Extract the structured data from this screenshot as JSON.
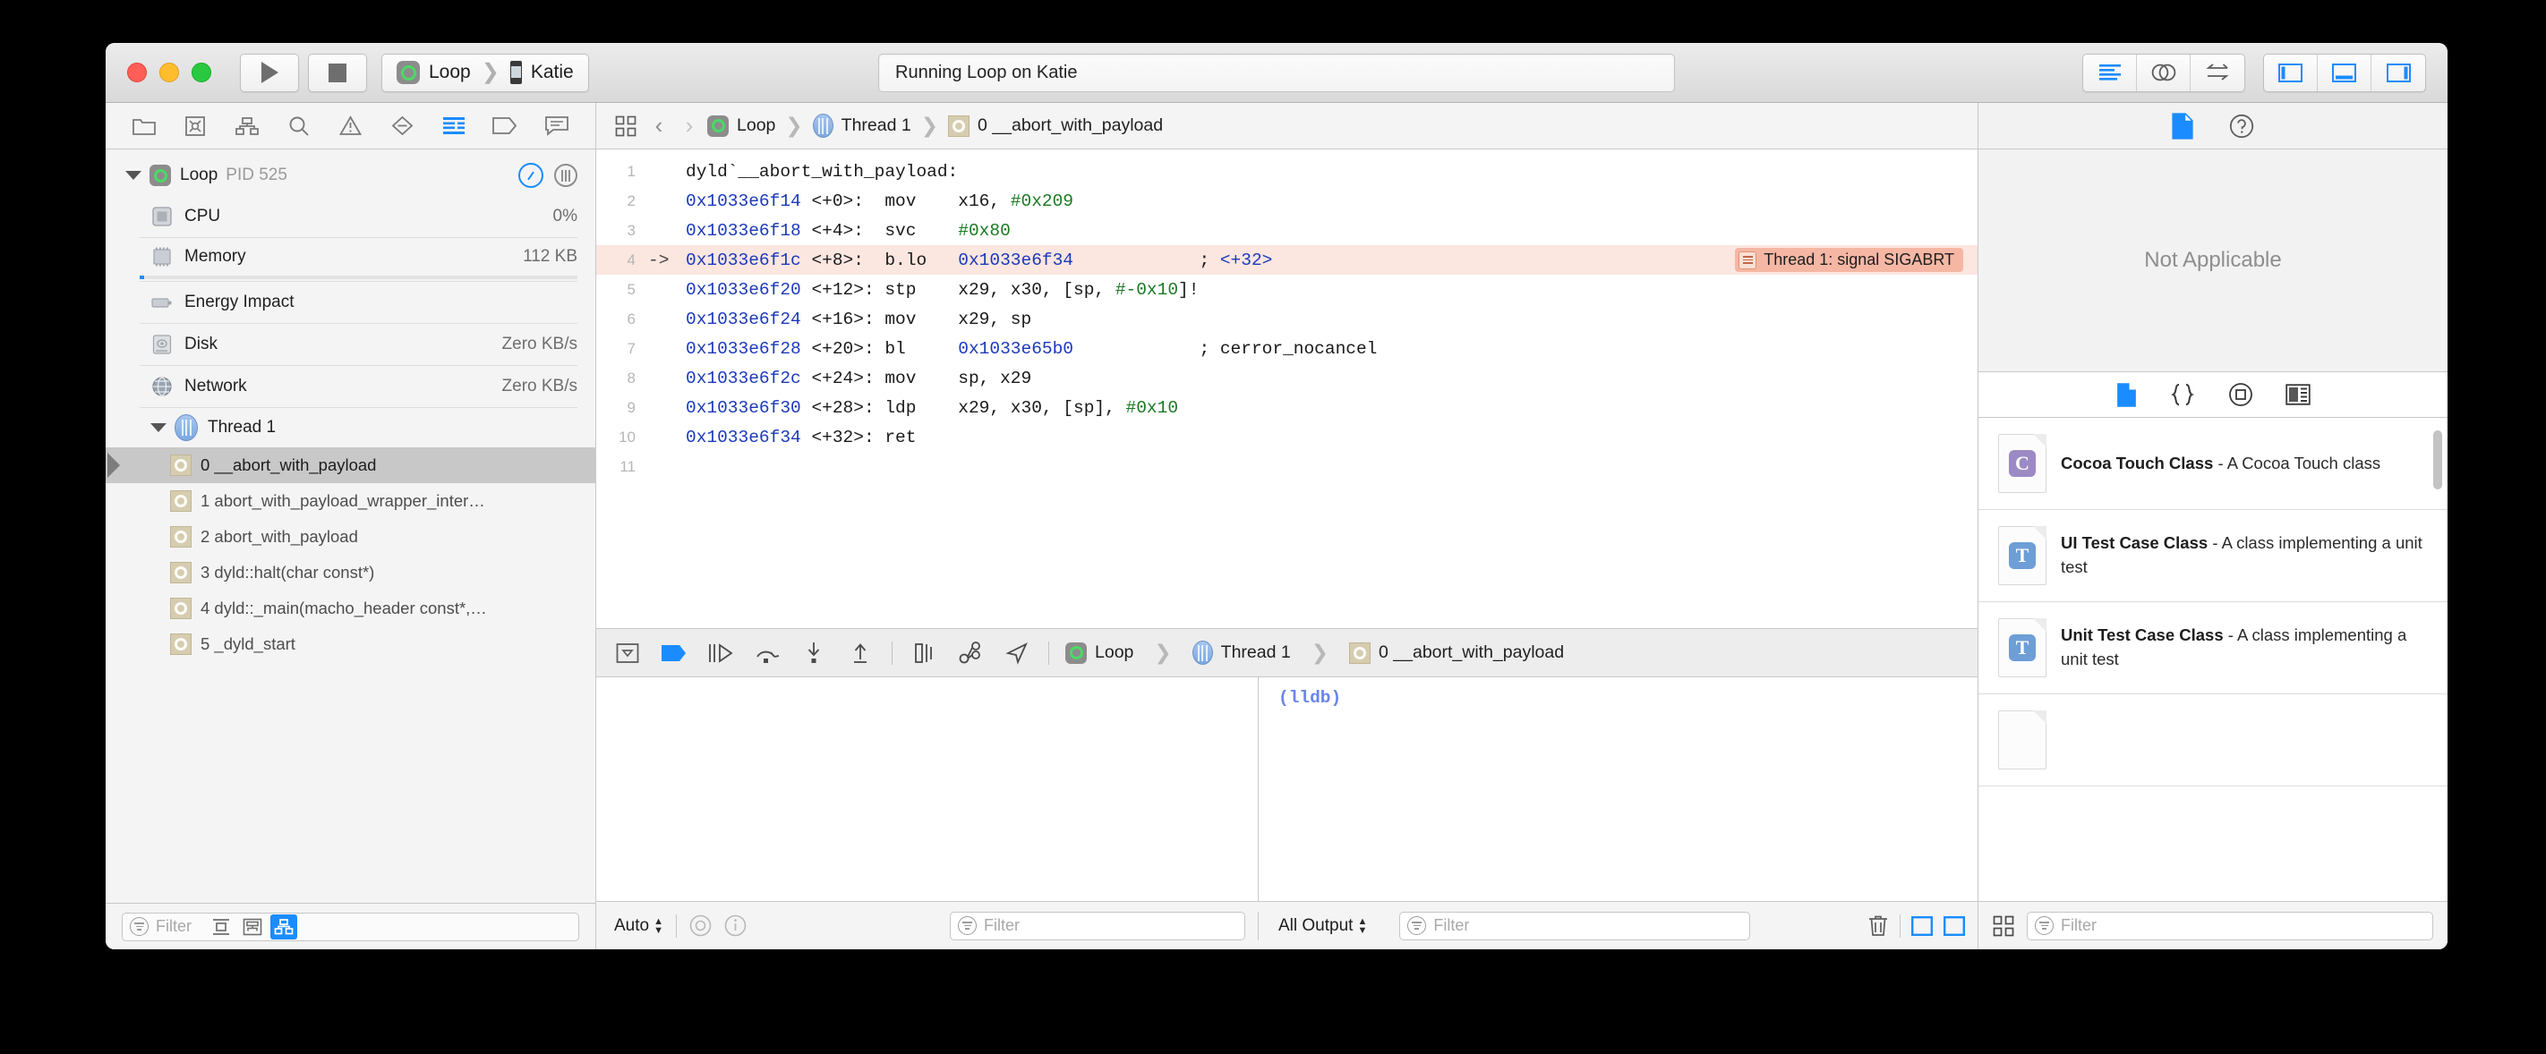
{
  "window": {
    "traffic_lights": [
      "close",
      "minimize",
      "zoom"
    ],
    "activity_title": "Running Loop on Katie",
    "run_button": "run-button",
    "stop_button": "stop-button",
    "scheme": {
      "target": "Loop",
      "device": "Katie"
    }
  },
  "toolbar": {
    "editor_buttons": [
      "standard-editor-icon",
      "assistant-editor-icon",
      "version-editor-icon"
    ],
    "panel_buttons": [
      "toggle-navigator-icon",
      "toggle-debug-area-icon",
      "toggle-inspector-icon"
    ]
  },
  "navigator": {
    "tabs": [
      "project-navigator-icon",
      "source-control-navigator-icon",
      "symbol-navigator-icon",
      "find-navigator-icon",
      "issue-navigator-icon",
      "test-navigator-icon",
      "debug-navigator-icon",
      "breakpoint-navigator-icon",
      "report-navigator-icon"
    ],
    "active_tab_index": 6,
    "process": {
      "name": "Loop",
      "pid_label": "PID 525"
    },
    "gauges": [
      {
        "label": "CPU",
        "value": "0%",
        "icon": "cpu-icon"
      },
      {
        "label": "Memory",
        "value": "112 KB",
        "icon": "memory-icon"
      },
      {
        "label": "Energy Impact",
        "value": "",
        "icon": "energy-icon"
      },
      {
        "label": "Disk",
        "value": "Zero KB/s",
        "icon": "disk-icon"
      },
      {
        "label": "Network",
        "value": "Zero KB/s",
        "icon": "network-icon"
      }
    ],
    "thread": {
      "label": "Thread 1"
    },
    "frames": [
      {
        "label": "0 __abort_with_payload",
        "selected": true
      },
      {
        "label": "1 abort_with_payload_wrapper_inter…",
        "selected": false
      },
      {
        "label": "2 abort_with_payload",
        "selected": false
      },
      {
        "label": "3 dyld::halt(char const*)",
        "selected": false
      },
      {
        "label": "4 dyld::_main(macho_header const*,…",
        "selected": false
      },
      {
        "label": "5 _dyld_start",
        "selected": false
      }
    ],
    "filter_placeholder": "Filter",
    "filter_value": "",
    "scope_buttons": [
      "show-only-crashed-icon",
      "show-only-relevant-icon",
      "show-all-threads-icon"
    ],
    "active_scope_index": 2
  },
  "jumpbar": {
    "related_items_icon": "related-items-icon",
    "back_label": "‹",
    "forward_label": "›",
    "crumbs": [
      "Loop",
      "Thread 1",
      "0 __abort_with_payload"
    ]
  },
  "source": {
    "lines": [
      {
        "num": "1",
        "arrow": "",
        "addr": "",
        "offset": "",
        "mnem": "dyld`__abort_with_payload:",
        "ops": "",
        "opsnum": "",
        "comment": "",
        "highlight": false
      },
      {
        "num": "2",
        "arrow": "",
        "addr": "0x1033e6f14",
        "offset": "<+0>:",
        "mnem": "mov",
        "ops": "x16, ",
        "opsnum": "#0x209",
        "comment": "",
        "highlight": false
      },
      {
        "num": "3",
        "arrow": "",
        "addr": "0x1033e6f18",
        "offset": "<+4>:",
        "mnem": "svc",
        "ops": "",
        "opsnum": "#0x80",
        "comment": "",
        "highlight": false
      },
      {
        "num": "4",
        "arrow": "->",
        "addr": "0x1033e6f1c",
        "offset": "<+8>:",
        "mnem": "b.lo",
        "ops": "",
        "opsnum": "",
        "opsaddr": "0x1033e6f34",
        "comment": "; ",
        "commentaddr": "<+32>",
        "highlight": true,
        "badge": "Thread 1: signal SIGABRT"
      },
      {
        "num": "5",
        "arrow": "",
        "addr": "0x1033e6f20",
        "offset": "<+12>:",
        "mnem": "stp",
        "ops": "x29, x30, [sp, ",
        "opsnum": "#-0x10",
        "opstail": "]!",
        "comment": "",
        "highlight": false
      },
      {
        "num": "6",
        "arrow": "",
        "addr": "0x1033e6f24",
        "offset": "<+16>:",
        "mnem": "mov",
        "ops": "x29, sp",
        "opsnum": "",
        "comment": "",
        "highlight": false
      },
      {
        "num": "7",
        "arrow": "",
        "addr": "0x1033e6f28",
        "offset": "<+20>:",
        "mnem": "bl",
        "ops": "",
        "opsnum": "",
        "opsaddr": "0x1033e65b0",
        "comment": "; cerror_nocancel",
        "highlight": false
      },
      {
        "num": "8",
        "arrow": "",
        "addr": "0x1033e6f2c",
        "offset": "<+24>:",
        "mnem": "mov",
        "ops": "sp, x29",
        "opsnum": "",
        "comment": "",
        "highlight": false
      },
      {
        "num": "9",
        "arrow": "",
        "addr": "0x1033e6f30",
        "offset": "<+28>:",
        "mnem": "ldp",
        "ops": "x29, x30, [sp], ",
        "opsnum": "#0x10",
        "comment": "",
        "highlight": false
      },
      {
        "num": "10",
        "arrow": "",
        "addr": "0x1033e6f34",
        "offset": "<+32>:",
        "mnem": "ret",
        "ops": "",
        "opsnum": "",
        "comment": "",
        "highlight": false
      },
      {
        "num": "11",
        "arrow": "",
        "addr": "",
        "offset": "",
        "mnem": "",
        "ops": "",
        "opsnum": "",
        "comment": "",
        "highlight": false
      }
    ]
  },
  "debugbar": {
    "buttons": [
      "hide-debug-area-icon",
      "deactivate-breakpoints-icon",
      "continue-icon",
      "step-over-icon",
      "step-into-icon",
      "step-out-icon",
      "debug-view-hierarchy-icon",
      "debug-memory-graph-icon",
      "simulate-location-icon"
    ],
    "crumbs": [
      "Loop",
      "Thread 1",
      "0 __abort_with_payload"
    ]
  },
  "console": {
    "prompt": "(lldb)"
  },
  "debugfooter": {
    "scope_popup": "Auto",
    "variables_filter_placeholder": "Filter",
    "variables_filter_value": "",
    "output_popup": "All Output",
    "console_filter_placeholder": "Filter",
    "console_filter_value": "",
    "clear_icon": "trash-icon",
    "split_buttons": [
      "show-variables-view-icon",
      "show-console-view-icon"
    ],
    "watch_icon": "watch-variable-icon",
    "info_icon": "info-icon"
  },
  "inspector": {
    "tabs": [
      "file-inspector-icon",
      "quick-help-inspector-icon"
    ],
    "active_tab_index": 0,
    "empty_message": "Not Applicable",
    "library_tabs": [
      "file-template-library-icon",
      "code-snippet-library-icon",
      "object-library-icon",
      "media-library-icon"
    ],
    "library_active_index": 0,
    "library_items": [
      {
        "title": "Cocoa Touch Class",
        "desc": "- A Cocoa Touch class",
        "badge": "C",
        "color": "#9b8ac4"
      },
      {
        "title": "UI Test Case Class",
        "desc": "- A class implementing a unit test",
        "badge": "T",
        "color": "#6d9ed6"
      },
      {
        "title": "Unit Test Case Class",
        "desc": "- A class implementing a unit test",
        "badge": "T",
        "color": "#6d9ed6"
      }
    ],
    "library_filter_placeholder": "Filter",
    "library_filter_value": "",
    "library_grid_icon": "library-grid-icon"
  },
  "colors": {
    "accent": "#1a8cff",
    "highlight_row": "#fbe6e0",
    "issue_badge": "#f5b7a4",
    "address": "#1c39bb",
    "number": "#1a7a23",
    "lldb": "#6a85e8"
  }
}
